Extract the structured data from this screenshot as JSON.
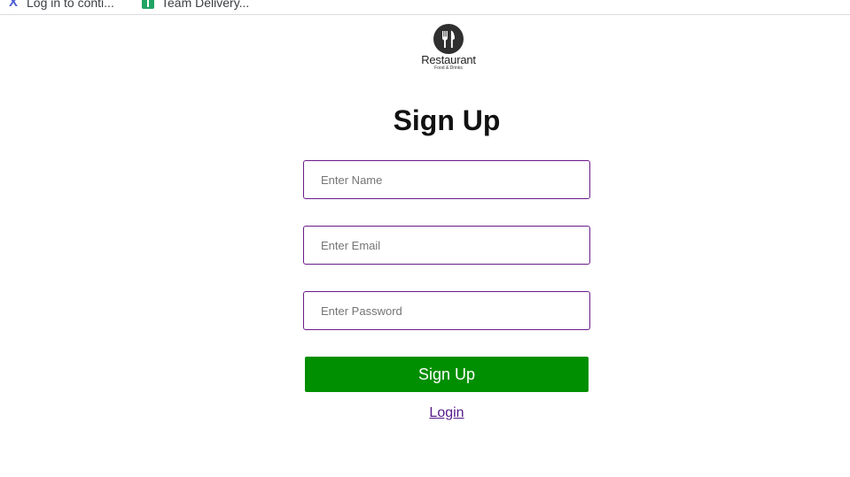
{
  "bookmarks": [
    {
      "label": "Log in to conti...",
      "icon": "blue-logo-icon"
    },
    {
      "label": "Team Delivery...",
      "icon": "green-sheet-icon"
    }
  ],
  "logo": {
    "title": "Restaurant",
    "subtitle": "Food & Drinks"
  },
  "form": {
    "title": "Sign Up",
    "name_placeholder": "Enter Name",
    "email_placeholder": "Enter Email",
    "password_placeholder": "Enter Password",
    "submit_label": "Sign Up",
    "login_label": "Login"
  },
  "colors": {
    "button": "#008f00",
    "input_border": "#6a1b8a",
    "link": "#551a8b"
  }
}
